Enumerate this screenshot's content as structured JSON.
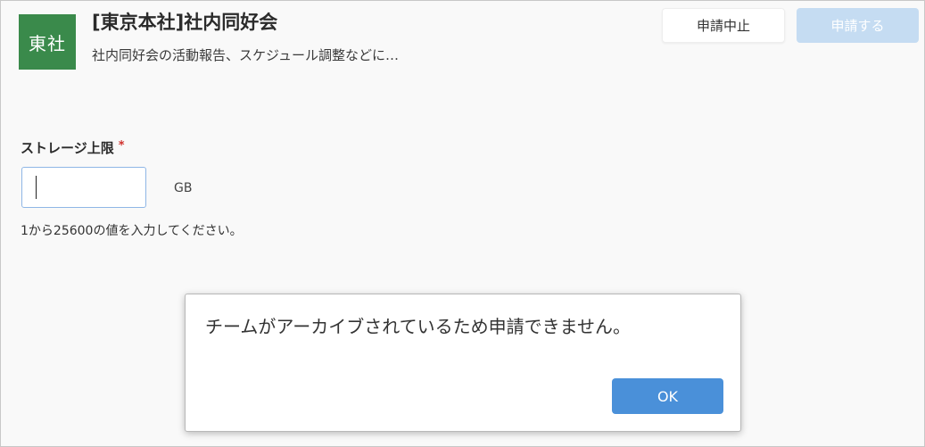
{
  "team": {
    "avatar_text": "東社",
    "title": "[東京本社]社内同好会",
    "description": "社内同好会の活動報告、スケジュール調整などに…",
    "avatar_color": "#3a8a4b"
  },
  "actions": {
    "cancel_label": "申請中止",
    "apply_label": "申請する",
    "apply_color": "#c5dcf2"
  },
  "form": {
    "storage_label": "ストレージ上限",
    "required_mark": "*",
    "storage_value": "",
    "unit": "GB",
    "helper": "1から25600の値を入力してください。"
  },
  "dialog": {
    "message": "チームがアーカイブされているため申請できません。",
    "ok_label": "OK",
    "ok_color": "#4a90d9"
  }
}
